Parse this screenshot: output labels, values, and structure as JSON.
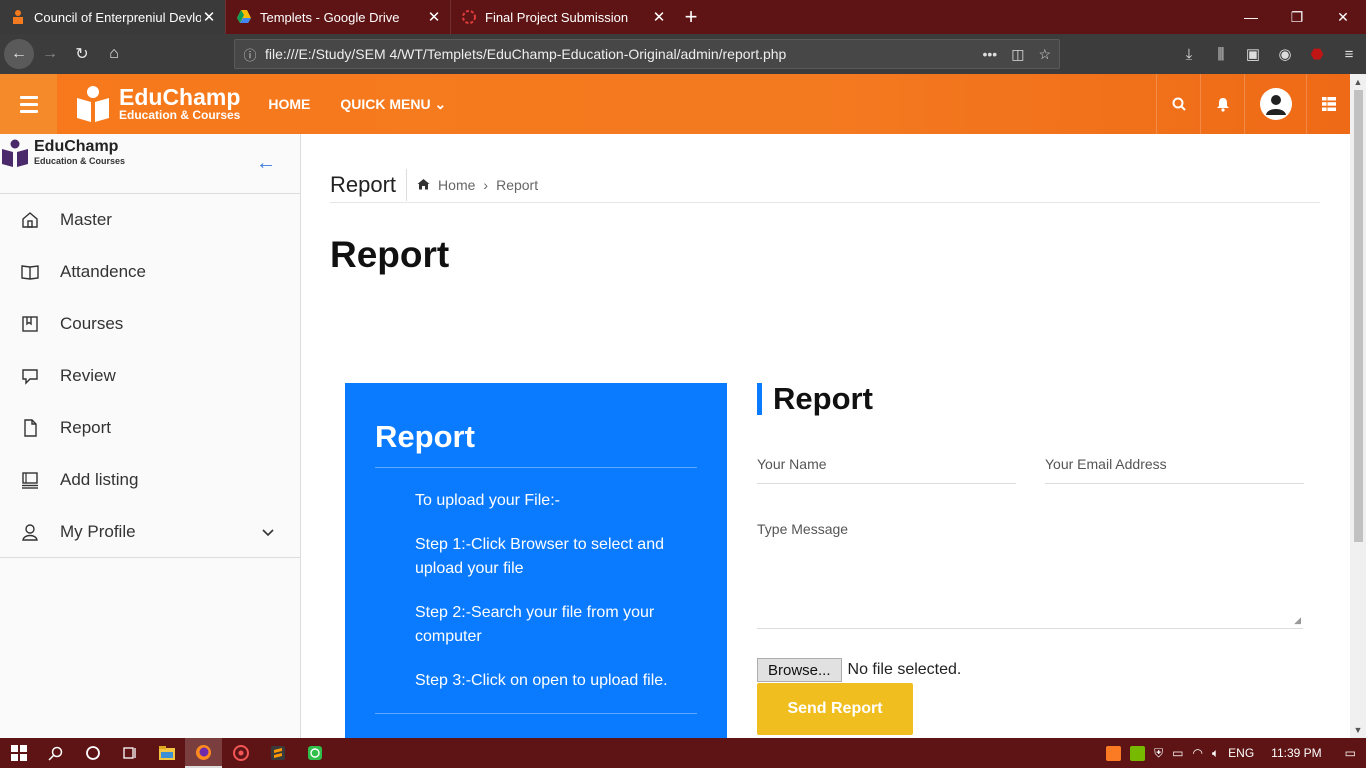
{
  "browser": {
    "tabs": [
      {
        "title": "Council of Enterpreniul Devlop",
        "active": true
      },
      {
        "title": "Templets - Google Drive",
        "active": false
      },
      {
        "title": "Final Project Submission",
        "active": false
      }
    ],
    "url": "file:///E:/Study/SEM 4/WT/Templets/EduChamp-Education-Original/admin/report.php"
  },
  "header": {
    "brand_name": "EduChamp",
    "brand_tagline": "Education & Courses",
    "nav": {
      "home": "HOME",
      "quick_menu": "QUICK MENU"
    },
    "accent_color": "#f47a20"
  },
  "sidebar": {
    "brand_name": "EduChamp",
    "brand_tagline": "Education & Courses",
    "items": [
      {
        "label": "Master",
        "icon": "home-icon"
      },
      {
        "label": "Attandence",
        "icon": "book-icon"
      },
      {
        "label": "Courses",
        "icon": "bookmark-icon"
      },
      {
        "label": "Review",
        "icon": "comment-icon"
      },
      {
        "label": "Report",
        "icon": "file-icon"
      },
      {
        "label": "Add listing",
        "icon": "list-icon"
      },
      {
        "label": "My Profile",
        "icon": "user-icon"
      }
    ]
  },
  "breadcrumb": {
    "title": "Report",
    "home": "Home",
    "current": "Report"
  },
  "page_title": "Report",
  "info_box": {
    "title": "Report",
    "color": "#0a7aff",
    "steps": [
      "To upload your File:-",
      "Step 1:-Click Browser to select and upload your file",
      "Step 2:-Search your file from your computer",
      "Step 3:-Click on open to upload file."
    ]
  },
  "form": {
    "title": "Report",
    "name_placeholder": "Your Name",
    "email_placeholder": "Your Email Address",
    "message_placeholder": "Type Message",
    "browse_label": "Browse...",
    "file_status": "No file selected.",
    "submit_label": "Send Report",
    "submit_color": "#f0bf1f"
  },
  "taskbar": {
    "language": "ENG",
    "time": "11:39 PM"
  }
}
